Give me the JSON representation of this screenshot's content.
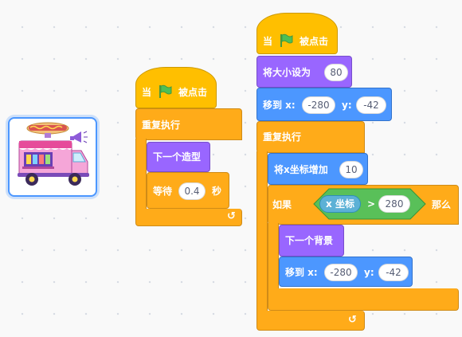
{
  "sprite": {
    "icon": "food-truck-icon"
  },
  "script_left": {
    "hat": {
      "label_when": "当",
      "label_clicked": "被点击"
    },
    "forever": {
      "label": "重复执行"
    },
    "next_costume": {
      "label": "下一个造型"
    },
    "wait": {
      "label": "等待",
      "value": "0.4",
      "unit": "秒"
    }
  },
  "script_right": {
    "hat": {
      "label_when": "当",
      "label_clicked": "被点击"
    },
    "set_size": {
      "label": "将大小设为",
      "value": "80"
    },
    "goto": {
      "label": "移到 x:",
      "x": "-280",
      "label_y": "y:",
      "y": "-42"
    },
    "forever": {
      "label": "重复执行"
    },
    "change_x": {
      "label": "将x坐标增加",
      "value": "10"
    },
    "if": {
      "label_if": "如果",
      "label_then": "那么",
      "reporter": "x 坐标",
      "operator": ">",
      "value": "280"
    },
    "next_backdrop": {
      "label": "下一个背景"
    },
    "goto_inner": {
      "label": "移到 x:",
      "x": "-280",
      "label_y": "y:",
      "y": "-42"
    }
  },
  "colors": {
    "events": "#ffbf00",
    "control": "#ffab19",
    "looks": "#9966ff",
    "motion": "#4c97ff",
    "operators": "#59c059",
    "sensing": "#5cb1d6"
  }
}
